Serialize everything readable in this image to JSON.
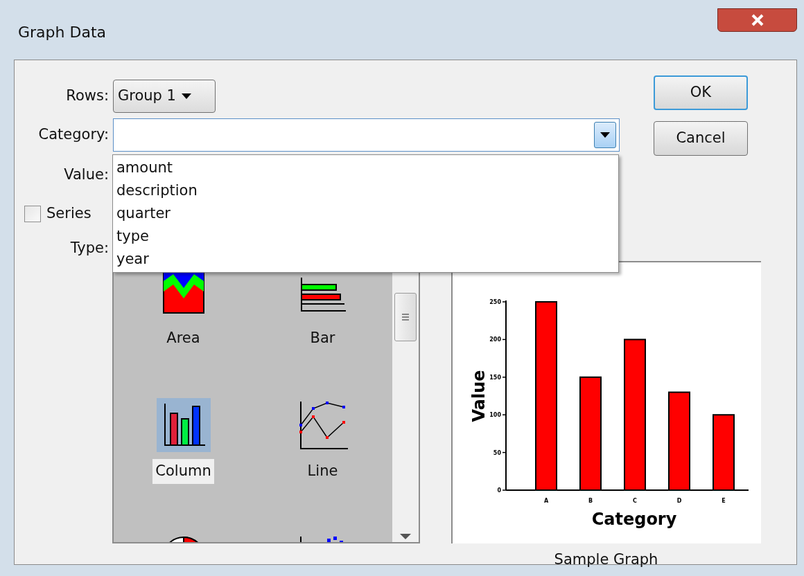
{
  "window": {
    "title": "Graph Data"
  },
  "form": {
    "rows_label": "Rows:",
    "rows_value": "Group 1",
    "category_label": "Category:",
    "value_label": "Value:",
    "series_label": "Series",
    "series_checked": false,
    "type_label": "Type:"
  },
  "category_dropdown": {
    "items": [
      "amount",
      "description",
      "quarter",
      "type",
      "year"
    ]
  },
  "chart_types": [
    {
      "kind": "area",
      "label": "Area",
      "selected": false
    },
    {
      "kind": "bar",
      "label": "Bar",
      "selected": false
    },
    {
      "kind": "column",
      "label": "Column",
      "selected": true
    },
    {
      "kind": "line",
      "label": "Line",
      "selected": false
    },
    {
      "kind": "pie",
      "selected": false
    },
    {
      "kind": "scatter",
      "selected": false
    }
  ],
  "buttons": [
    "OK",
    "Cancel"
  ],
  "preview": {
    "caption": "Sample Graph",
    "chart_data": {
      "type": "bar",
      "xlabel": "Category",
      "ylabel": "Value",
      "categories": [
        "A",
        "B",
        "C",
        "D",
        "E"
      ],
      "series": [
        {
          "color": "#ff0000",
          "values": [
            250,
            150,
            200,
            130,
            100
          ]
        }
      ],
      "ylim": [
        0,
        250
      ],
      "yticks": [
        0,
        50,
        100,
        150,
        200,
        250
      ]
    }
  }
}
